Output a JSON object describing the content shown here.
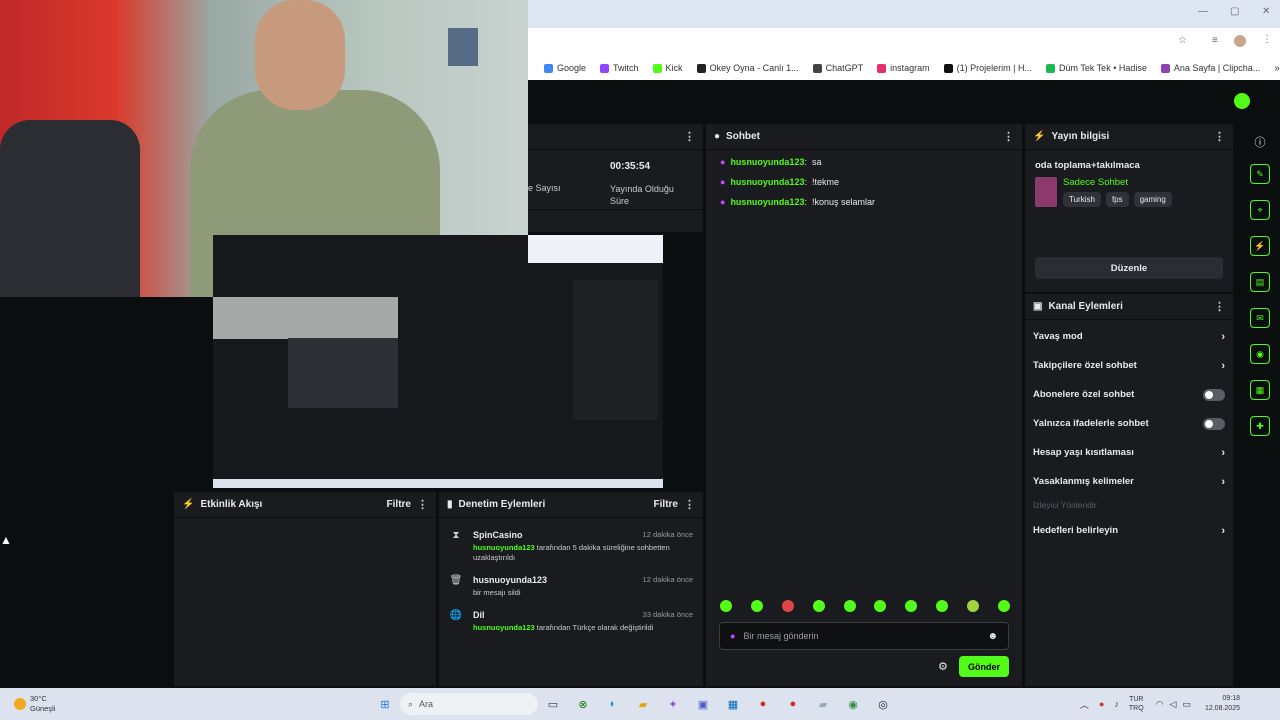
{
  "bookmarks": [
    {
      "label": "Google",
      "color": "#4285f4"
    },
    {
      "label": "Twitch",
      "color": "#9146ff"
    },
    {
      "label": "Kick",
      "color": "#53fc18"
    },
    {
      "label": "Okey Oyna - Canlı 1...",
      "color": "#222"
    },
    {
      "label": "ChatGPT",
      "color": "#444"
    },
    {
      "label": "instagram",
      "color": "#e1306c"
    },
    {
      "label": "(1) Projelerim | H...",
      "color": "#111"
    },
    {
      "label": "Düm Tek Tek • Hadise",
      "color": "#1db954"
    },
    {
      "label": "Ana Sayfa | Clipcha...",
      "color": "#8e44ad"
    }
  ],
  "stats": {
    "stream_time": "00:35:54",
    "stream_time_label": "Yayında Olduğu Süre",
    "viewer_label": "e Sayısı"
  },
  "chat": {
    "title": "Sohbet",
    "messages": [
      {
        "user": "husnuoyunda123",
        "text": "sa"
      },
      {
        "user": "husnuoyunda123",
        "text": "!tekme"
      },
      {
        "user": "husnuoyunda123",
        "text": "!konuş selamlar"
      }
    ],
    "input_placeholder": "Bir mesaj gönderin",
    "send_label": "Gönder"
  },
  "stream_info": {
    "title": "Yayın bilgisi",
    "stream_title": "oda toplama+takılmaca",
    "category": "Sadece Sohbet",
    "tags": [
      "Turkish",
      "fps",
      "gaming"
    ],
    "edit_label": "Düzenle"
  },
  "channel_actions": {
    "title": "Kanal Eylemleri",
    "items": [
      {
        "label": "Yavaş mod",
        "control": "chevron"
      },
      {
        "label": "Takipçilere özel sohbet",
        "control": "chevron"
      },
      {
        "label": "Abonelere özel sohbet",
        "control": "toggle"
      },
      {
        "label": "Yalnızca ifadelerle sohbet",
        "control": "toggle"
      },
      {
        "label": "Hesap yaşı kısıtlaması",
        "control": "chevron"
      },
      {
        "label": "Yasaklanmış kelimeler",
        "control": "chevron"
      }
    ],
    "disabled_label": "İzleyici Yönlendir",
    "targets_label": "Hedefleri belirleyin"
  },
  "activity": {
    "title": "Etkinlik Akışı",
    "filter": "Filtre"
  },
  "moderation": {
    "title": "Denetim Eylemleri",
    "filter": "Filtre",
    "entries": [
      {
        "icon": "⧗",
        "title": "SpinCasino",
        "time": "12 dakika önce",
        "user": "husnuoyunda123",
        "rest": " tarafından 5 dakika süreliğine sohbetten uzaklaştırıldı"
      },
      {
        "icon": "🗑",
        "title": "husnuoyunda123",
        "time": "12 dakika önce",
        "user": "",
        "rest": "bir mesajı sildi"
      },
      {
        "icon": "🌐",
        "title": "Dil",
        "time": "33 dakika önce",
        "user": "husnuoyunda123",
        "rest": " tarafından Türkçe olarak değiştirildi"
      }
    ]
  },
  "taskbar": {
    "weather_temp": "30°C",
    "weather_desc": "Güneşli",
    "search": "Ara",
    "lang1": "TUR",
    "lang2": "TRQ",
    "time": "09:18",
    "date": "12.08.2025"
  }
}
